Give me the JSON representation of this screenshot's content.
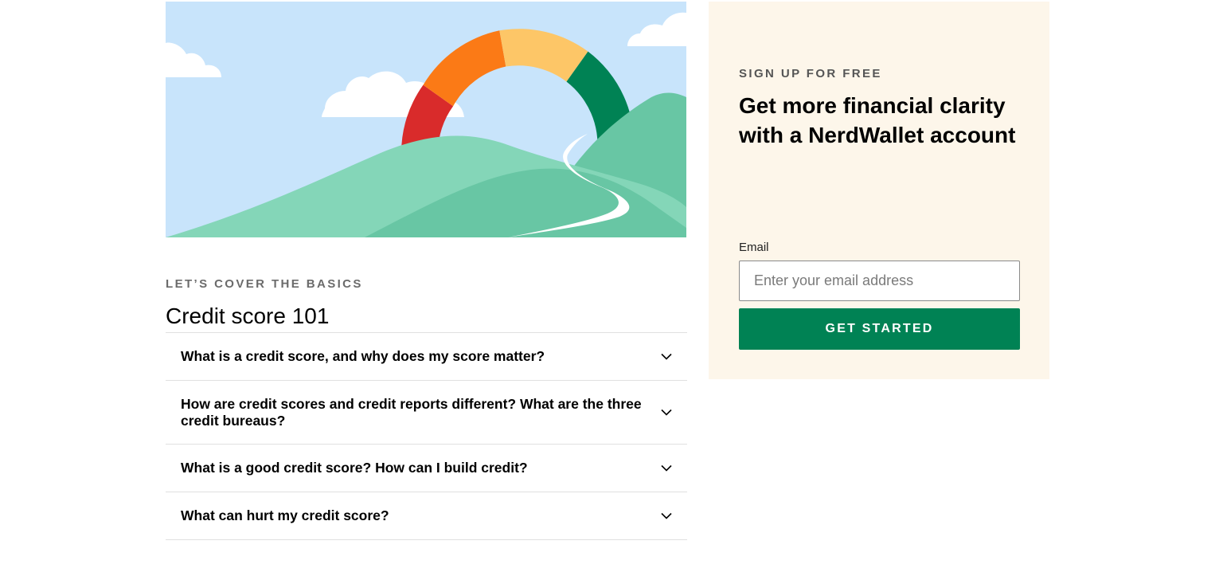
{
  "hero": {
    "image_name": "credit-score-gauge-hills-illustration"
  },
  "basics": {
    "eyebrow": "LET’S COVER THE BASICS",
    "title": "Credit score 101",
    "questions": [
      {
        "label": "What is a credit score, and why does my score matter?"
      },
      {
        "label": "How are credit scores and credit reports different? What are the three credit bureaus?"
      },
      {
        "label": "What is a good credit score? How can I build credit?"
      },
      {
        "label": "What can hurt my credit score?"
      }
    ]
  },
  "signup": {
    "eyebrow": "SIGN UP FOR FREE",
    "title": "Get more financial clarity with a NerdWallet account",
    "email_label": "Email",
    "email_placeholder": "Enter your email address",
    "email_value": "",
    "button_label": "GET STARTED"
  },
  "colors": {
    "brand_green": "#008254",
    "signup_bg": "#fdf6ea",
    "sky": "#c8e4fb",
    "gauge": [
      "#d92b2b",
      "#fb7a16",
      "#fdc667",
      "#008254"
    ]
  },
  "icons": {
    "accordion": "chevron-down-icon"
  }
}
